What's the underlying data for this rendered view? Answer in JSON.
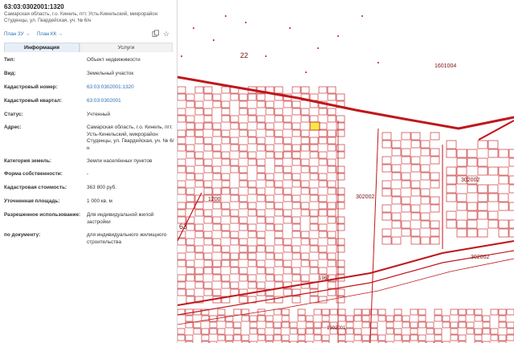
{
  "header": {
    "cad_number": "63:03:0302001:1320",
    "address_short": "Самарская область, г.о. Кинель, пгт. Усть-Кинельский, микрорайон Студенцы, ул. Гвардейская, уч. № 6/н"
  },
  "toolbar": {
    "plan_zu": "План ЗУ →",
    "plan_kk": "План КК →",
    "icons": [
      "copy-icon",
      "star-icon"
    ]
  },
  "tabs": {
    "info": "Информация",
    "services": "Услуги"
  },
  "fields": [
    {
      "label": "Тип:",
      "value": "Объект недвижимости",
      "link": false
    },
    {
      "label": "Вид:",
      "value": "Земельный участок",
      "link": false
    },
    {
      "label": "Кадастровый номер:",
      "value": "63:03:0302001:1320",
      "link": true
    },
    {
      "label": "Кадастровый квартал:",
      "value": "63:03:0302001",
      "link": true
    },
    {
      "label": "Статус:",
      "value": "Учтенный",
      "link": false
    },
    {
      "label": "Адрес:",
      "value": "Самарская область, г.о. Кинель, пгт. Усть-Кинельский, микрорайон Студенцы, ул. Гвардейская, уч. № 6/н",
      "link": false
    },
    {
      "label": "Категория земель:",
      "value": "Земли населённых пунктов",
      "link": false
    },
    {
      "label": "Форма собственности:",
      "value": "-",
      "link": false
    },
    {
      "label": "Кадастровая стоимость:",
      "value": "363 800 руб.",
      "link": false
    },
    {
      "label": "Уточненная площадь:",
      "value": "1 000 кв. м",
      "link": false
    },
    {
      "label": "Разрешенное использование:",
      "value": "Для индивидуальной жилой застройки",
      "link": false
    },
    {
      "label": "по документу:",
      "value": "для индивидуального жилищного строительства",
      "link": false
    }
  ],
  "map": {
    "labels": [
      "22",
      "1601004",
      "302002",
      "302002",
      "302002",
      "1200",
      "63",
      "1302001",
      "1967"
    ],
    "line_color": "#c0161b",
    "selected_fill": "#f5e94a"
  }
}
